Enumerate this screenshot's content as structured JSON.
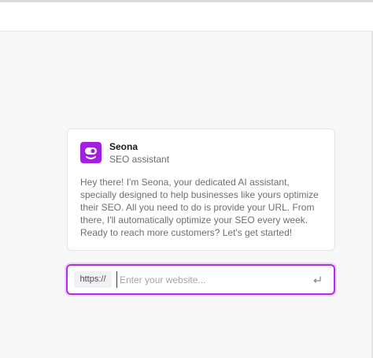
{
  "assistant": {
    "name": "Seona",
    "role": "SEO assistant",
    "avatar_icon": "seona-robot-icon",
    "avatar_color": "#a21fe0",
    "message": "Hey there! I'm Seona, your dedicated AI assistant, specially designed to help businesses like yours optimize their SEO. All you need to do is provide your URL. From there, I'll automatically optimize your SEO every week. Ready to reach more customers? Let's get started!"
  },
  "url_form": {
    "prefix": "https://",
    "placeholder": "Enter your website...",
    "value": "",
    "submit_icon": "enter-return-icon",
    "focus_color": "#b02ee6"
  }
}
